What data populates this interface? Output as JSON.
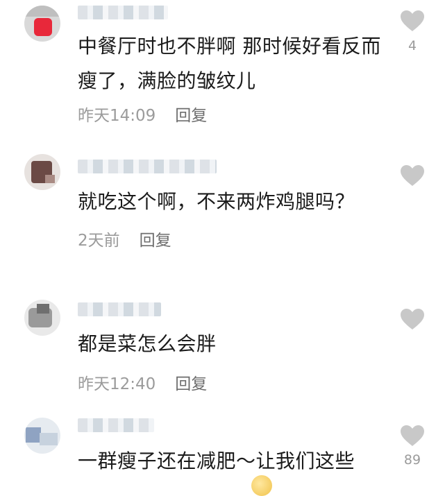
{
  "comments": [
    {
      "text": "中餐厅时也不胖啊 那时候好看反而瘦了，满脸的皱纹儿",
      "time": "昨天14:09",
      "reply": "回复",
      "likes": "4"
    },
    {
      "text": "就吃这个啊，不来两炸鸡腿吗？",
      "time": "2天前",
      "reply": "回复",
      "likes": ""
    },
    {
      "text": "都是菜怎么会胖",
      "time": "昨天12:40",
      "reply": "回复",
      "likes": ""
    },
    {
      "text": "一群瘦子还在减肥～让我们这些",
      "time": "",
      "reply": "",
      "likes": "89"
    }
  ],
  "icons": {
    "like": "heart-icon"
  },
  "colors": {
    "heart": "#c8c8c8",
    "meta": "#9b9b9b",
    "text": "#1b1b1b"
  }
}
